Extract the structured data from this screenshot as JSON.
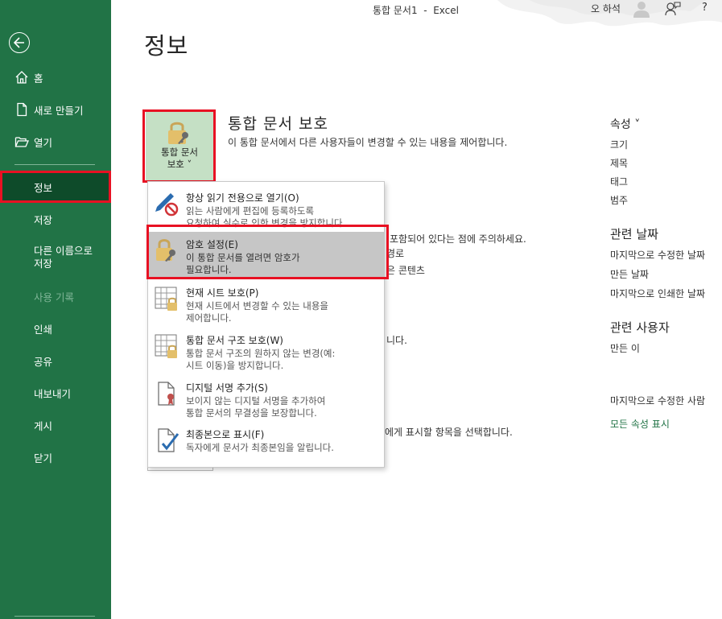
{
  "window": {
    "title": "통합 문서1  -  Excel",
    "user": "오 하석",
    "help": "?"
  },
  "sidebar": {
    "items": [
      {
        "label": "홈"
      },
      {
        "label": "새로 만들기"
      },
      {
        "label": "열기"
      },
      {
        "label": "정보"
      },
      {
        "label": "저장"
      },
      {
        "label": "다른 이름으로\n저장"
      },
      {
        "label": "사용 기록"
      },
      {
        "label": "인쇄"
      },
      {
        "label": "공유"
      },
      {
        "label": "내보내기"
      },
      {
        "label": "게시"
      },
      {
        "label": "닫기"
      }
    ]
  },
  "page": {
    "title": "정보"
  },
  "protect": {
    "button_line1": "통합 문서",
    "button_line2": "보호 ˅",
    "heading": "통합 문서 보호",
    "description": "이 통합 문서에서 다른 사용자들이 변경할 수 있는 내용을 제어합니다."
  },
  "background_fragments": {
    "line1": "포함되어 있다는 점에 주의하세요.",
    "line2": "경로",
    "line3": "은 콘텐츠",
    "line4": "니다.",
    "line5": "에게 표시할 항목을 선택합니다."
  },
  "menu": {
    "items": [
      {
        "title": "항상 읽기 전용으로 열기(O)",
        "desc": "읽는 사람에게 편집에 등록하도록\n요청하여 실수로 인한 변경을 방지합니다.",
        "icon": "pencil-no-icon"
      },
      {
        "title": "암호 설정(E)",
        "desc": "이 통합 문서를 열려면 암호가\n필요합니다.",
        "icon": "lock-key-icon"
      },
      {
        "title": "현재 시트 보호(P)",
        "desc": "현재 시트에서 변경할 수 있는 내용을\n제어합니다.",
        "icon": "sheet-lock-icon"
      },
      {
        "title": "통합 문서 구조 보호(W)",
        "desc": "통합 문서 구조의 원하지 않는 변경(예:\n시트 이동)을 방지합니다.",
        "icon": "workbook-lock-icon"
      },
      {
        "title": "디지털 서명 추가(S)",
        "desc": "보이지 않는 디지털 서명을 추가하여\n통합 문서의 무결성을 보장합니다.",
        "icon": "signature-ribbon-icon"
      },
      {
        "title": "최종본으로 표시(F)",
        "desc": "독자에게 문서가 최종본임을 알립니다.",
        "icon": "document-check-icon"
      }
    ]
  },
  "properties": {
    "heading": "속성 ˅",
    "items": [
      "크기",
      "제목",
      "태그",
      "범주"
    ],
    "dates_heading": "관련 날짜",
    "dates": [
      "마지막으로 수정한 날짜",
      "만든 날짜",
      "마지막으로 인쇄한 날짜"
    ],
    "people_heading": "관련 사용자",
    "people": [
      "만든 이"
    ],
    "last_modified_by": "마지막으로 수정한 사람",
    "show_all": "모든 속성 표시"
  },
  "colors": {
    "accent": "#217346",
    "active_nav": "#0e4b2a",
    "highlight_outline": "#e81123"
  }
}
